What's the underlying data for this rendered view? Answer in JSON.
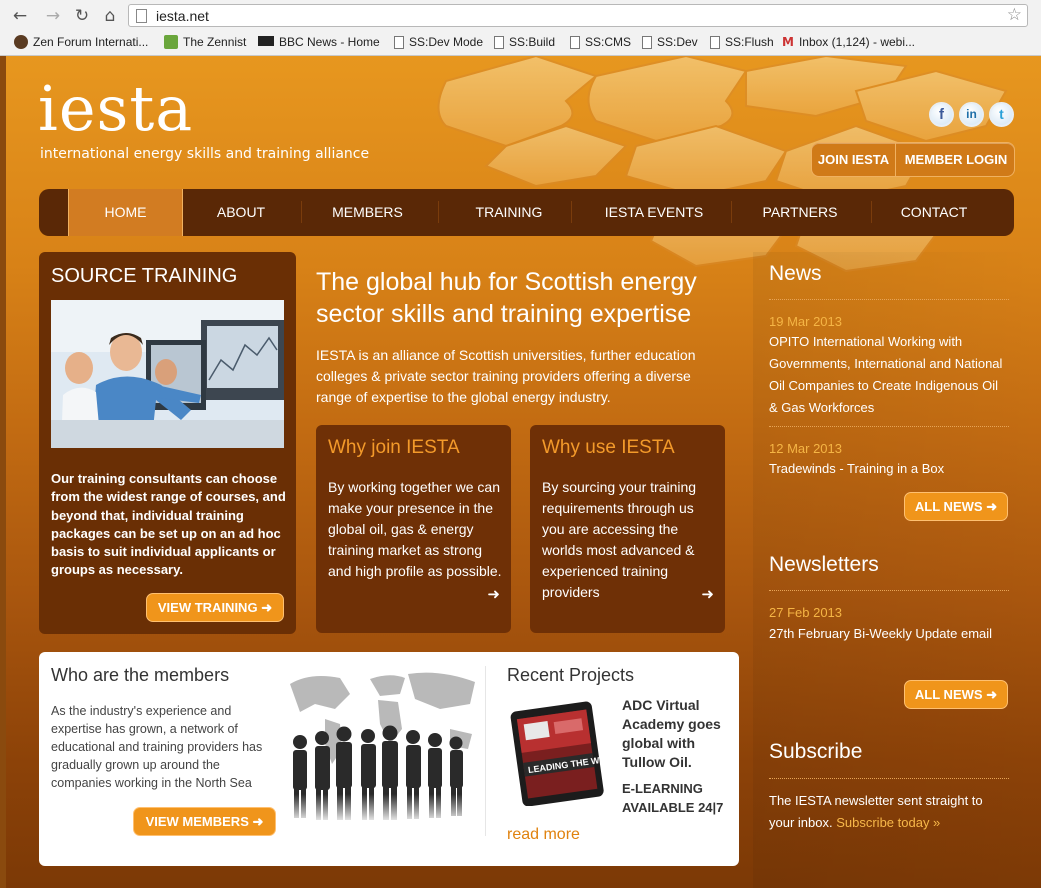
{
  "browser": {
    "url": "iesta.net",
    "bookmarks": [
      {
        "label": "Zen Forum Internati...",
        "icon": "avatar-icon"
      },
      {
        "label": "The Zennist",
        "icon": "leaf-icon"
      },
      {
        "label": "BBC News - Home",
        "icon": "bbc-icon"
      },
      {
        "label": "SS:Dev Mode",
        "icon": "page-icon"
      },
      {
        "label": "SS:Build",
        "icon": "page-icon"
      },
      {
        "label": "SS:CMS",
        "icon": "page-icon"
      },
      {
        "label": "SS:Dev",
        "icon": "page-icon"
      },
      {
        "label": "SS:Flush",
        "icon": "page-icon"
      },
      {
        "label": "Inbox (1,124) - webi...",
        "icon": "gmail-icon"
      }
    ]
  },
  "header": {
    "logo": "iesta",
    "tagline": "international energy skills and training alliance",
    "social": {
      "facebook": "f",
      "linkedin": "in",
      "twitter": "t"
    },
    "join_label": "JOIN IESTA",
    "login_label": "MEMBER LOGIN"
  },
  "nav": [
    "HOME",
    "ABOUT",
    "MEMBERS",
    "TRAINING",
    "IESTA EVENTS",
    "PARTNERS",
    "CONTACT"
  ],
  "source": {
    "title": "SOURCE TRAINING",
    "text": "Our training consultants can choose from the widest range of courses, and beyond that, individual training packages can be set up on an ad hoc basis to suit individual applicants or groups as necessary.",
    "button": "VIEW TRAINING"
  },
  "hub": {
    "title": "The global hub for Scottish energy sector skills and training expertise",
    "text": "IESTA is an alliance of Scottish universities, further education colleges & private sector training providers offering a diverse range of expertise to the global energy industry."
  },
  "why_join": {
    "title": "Why join IESTA",
    "text": "By working together we can make your presence in the global oil, gas & energy training market as strong and high profile as possible."
  },
  "why_use": {
    "title": "Why use IESTA",
    "text": "By sourcing your training requirements through us you are accessing the worlds most advanced & experienced training providers"
  },
  "news": {
    "heading": "News",
    "items": [
      {
        "date": "19 Mar 2013",
        "text": "OPITO International Working with Governments, International and National Oil Companies to Create Indigenous Oil & Gas Workforces"
      },
      {
        "date": "12 Mar 2013",
        "text": "Tradewinds - Training in a Box"
      }
    ],
    "button": "ALL NEWS"
  },
  "newsletters": {
    "heading": "Newsletters",
    "items": [
      {
        "date": "27 Feb 2013",
        "text": "27th February Bi-Weekly Update email"
      }
    ],
    "button": "ALL NEWS"
  },
  "subscribe": {
    "heading": "Subscribe",
    "text": "The IESTA newsletter sent straight to your inbox.",
    "link": "Subscribe today »"
  },
  "members": {
    "title": "Who are the members",
    "text": "As the industry's experience and expertise has grown, a network of educational and training providers has gradually grown up around the companies working in the North Sea",
    "button": "VIEW MEMBERS"
  },
  "projects": {
    "title": "Recent Projects",
    "project_title": "ADC Virtual Academy goes global with Tullow Oil.",
    "project_sub": "E-LEARNING AVAILABLE 24|7",
    "tablet_text": "LEADING THE WO",
    "read_more": "read more"
  },
  "colors": {
    "accent": "#f0951b",
    "nav_bg": "#5a2806",
    "panel_bg": "#6f3006",
    "date": "#f5b545"
  }
}
